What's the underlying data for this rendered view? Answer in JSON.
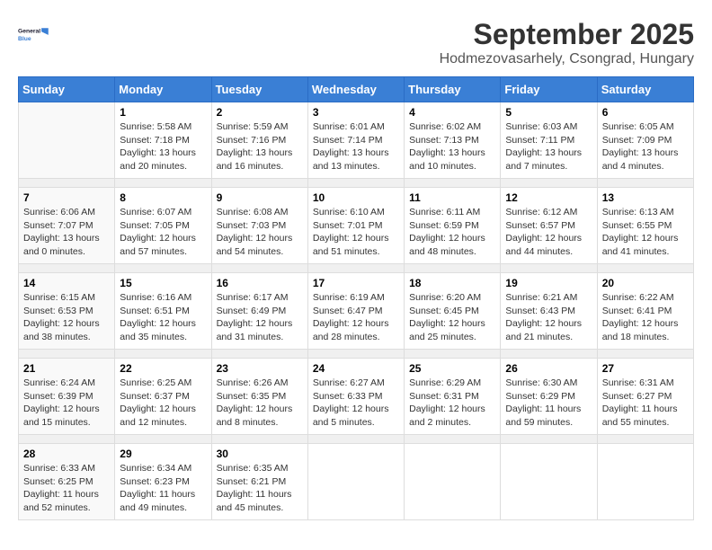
{
  "header": {
    "logo_line1": "General",
    "logo_line2": "Blue",
    "month": "September 2025",
    "location": "Hodmezovasarhely, Csongrad, Hungary"
  },
  "days_of_week": [
    "Sunday",
    "Monday",
    "Tuesday",
    "Wednesday",
    "Thursday",
    "Friday",
    "Saturday"
  ],
  "weeks": [
    [
      {
        "day": "",
        "content": ""
      },
      {
        "day": "1",
        "content": "Sunrise: 5:58 AM\nSunset: 7:18 PM\nDaylight: 13 hours\nand 20 minutes."
      },
      {
        "day": "2",
        "content": "Sunrise: 5:59 AM\nSunset: 7:16 PM\nDaylight: 13 hours\nand 16 minutes."
      },
      {
        "day": "3",
        "content": "Sunrise: 6:01 AM\nSunset: 7:14 PM\nDaylight: 13 hours\nand 13 minutes."
      },
      {
        "day": "4",
        "content": "Sunrise: 6:02 AM\nSunset: 7:13 PM\nDaylight: 13 hours\nand 10 minutes."
      },
      {
        "day": "5",
        "content": "Sunrise: 6:03 AM\nSunset: 7:11 PM\nDaylight: 13 hours\nand 7 minutes."
      },
      {
        "day": "6",
        "content": "Sunrise: 6:05 AM\nSunset: 7:09 PM\nDaylight: 13 hours\nand 4 minutes."
      }
    ],
    [
      {
        "day": "7",
        "content": "Sunrise: 6:06 AM\nSunset: 7:07 PM\nDaylight: 13 hours\nand 0 minutes."
      },
      {
        "day": "8",
        "content": "Sunrise: 6:07 AM\nSunset: 7:05 PM\nDaylight: 12 hours\nand 57 minutes."
      },
      {
        "day": "9",
        "content": "Sunrise: 6:08 AM\nSunset: 7:03 PM\nDaylight: 12 hours\nand 54 minutes."
      },
      {
        "day": "10",
        "content": "Sunrise: 6:10 AM\nSunset: 7:01 PM\nDaylight: 12 hours\nand 51 minutes."
      },
      {
        "day": "11",
        "content": "Sunrise: 6:11 AM\nSunset: 6:59 PM\nDaylight: 12 hours\nand 48 minutes."
      },
      {
        "day": "12",
        "content": "Sunrise: 6:12 AM\nSunset: 6:57 PM\nDaylight: 12 hours\nand 44 minutes."
      },
      {
        "day": "13",
        "content": "Sunrise: 6:13 AM\nSunset: 6:55 PM\nDaylight: 12 hours\nand 41 minutes."
      }
    ],
    [
      {
        "day": "14",
        "content": "Sunrise: 6:15 AM\nSunset: 6:53 PM\nDaylight: 12 hours\nand 38 minutes."
      },
      {
        "day": "15",
        "content": "Sunrise: 6:16 AM\nSunset: 6:51 PM\nDaylight: 12 hours\nand 35 minutes."
      },
      {
        "day": "16",
        "content": "Sunrise: 6:17 AM\nSunset: 6:49 PM\nDaylight: 12 hours\nand 31 minutes."
      },
      {
        "day": "17",
        "content": "Sunrise: 6:19 AM\nSunset: 6:47 PM\nDaylight: 12 hours\nand 28 minutes."
      },
      {
        "day": "18",
        "content": "Sunrise: 6:20 AM\nSunset: 6:45 PM\nDaylight: 12 hours\nand 25 minutes."
      },
      {
        "day": "19",
        "content": "Sunrise: 6:21 AM\nSunset: 6:43 PM\nDaylight: 12 hours\nand 21 minutes."
      },
      {
        "day": "20",
        "content": "Sunrise: 6:22 AM\nSunset: 6:41 PM\nDaylight: 12 hours\nand 18 minutes."
      }
    ],
    [
      {
        "day": "21",
        "content": "Sunrise: 6:24 AM\nSunset: 6:39 PM\nDaylight: 12 hours\nand 15 minutes."
      },
      {
        "day": "22",
        "content": "Sunrise: 6:25 AM\nSunset: 6:37 PM\nDaylight: 12 hours\nand 12 minutes."
      },
      {
        "day": "23",
        "content": "Sunrise: 6:26 AM\nSunset: 6:35 PM\nDaylight: 12 hours\nand 8 minutes."
      },
      {
        "day": "24",
        "content": "Sunrise: 6:27 AM\nSunset: 6:33 PM\nDaylight: 12 hours\nand 5 minutes."
      },
      {
        "day": "25",
        "content": "Sunrise: 6:29 AM\nSunset: 6:31 PM\nDaylight: 12 hours\nand 2 minutes."
      },
      {
        "day": "26",
        "content": "Sunrise: 6:30 AM\nSunset: 6:29 PM\nDaylight: 11 hours\nand 59 minutes."
      },
      {
        "day": "27",
        "content": "Sunrise: 6:31 AM\nSunset: 6:27 PM\nDaylight: 11 hours\nand 55 minutes."
      }
    ],
    [
      {
        "day": "28",
        "content": "Sunrise: 6:33 AM\nSunset: 6:25 PM\nDaylight: 11 hours\nand 52 minutes."
      },
      {
        "day": "29",
        "content": "Sunrise: 6:34 AM\nSunset: 6:23 PM\nDaylight: 11 hours\nand 49 minutes."
      },
      {
        "day": "30",
        "content": "Sunrise: 6:35 AM\nSunset: 6:21 PM\nDaylight: 11 hours\nand 45 minutes."
      },
      {
        "day": "",
        "content": ""
      },
      {
        "day": "",
        "content": ""
      },
      {
        "day": "",
        "content": ""
      },
      {
        "day": "",
        "content": ""
      }
    ]
  ]
}
